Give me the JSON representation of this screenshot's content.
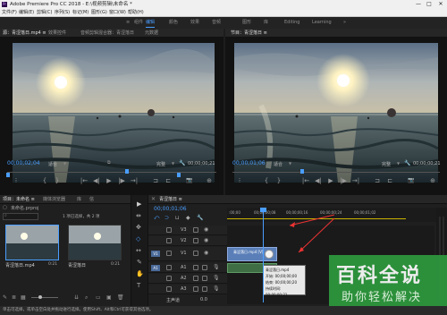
{
  "app": {
    "title": "Adobe Premiere Pro CC 2018 - E:\\视频剪辑\\未命名 *",
    "icon_label": "Pr",
    "window_controls": [
      "—",
      "□",
      "✕"
    ]
  },
  "menu": [
    "文件(F)",
    "编辑(E)",
    "剪辑(C)",
    "序列(S)",
    "标记(M)",
    "图形(G)",
    "窗口(W)",
    "帮助(H)"
  ],
  "workspaces": [
    "≡",
    "组件",
    "编辑",
    "颜色",
    "效果",
    "音频",
    "图形",
    "库",
    "Editing",
    "Learning",
    "»"
  ],
  "workspace_active": "编辑",
  "source_monitor": {
    "tabs": [
      "源：青涩落日.mp4 ≡",
      "效果控件",
      "音频剪辑混合器：青涩落日",
      "元数据"
    ],
    "timecode_left": "00;00;02;04",
    "fit": "适合",
    "quality": "完整",
    "timecode_right": "00;00;00;21"
  },
  "program_monitor": {
    "tab": "节目：青涩落日 ≡",
    "timecode_left": "00;00;01;06",
    "fit": "适合",
    "quality": "完整",
    "timecode_right": "00;00;00;21"
  },
  "transport": [
    "⁝",
    "{",
    "}",
    "|←",
    "◀|",
    "▶",
    "|▶",
    "→|",
    "⊐",
    "⊏",
    "📷",
    "⊕"
  ],
  "project": {
    "tabs": [
      "项目：未命名 ≡",
      "媒体浏览器",
      "库",
      "信"
    ],
    "file": "未命名.prproj",
    "count": "1 项已选择，共 2 项",
    "clips": [
      {
        "name": "青涩落日.mp4",
        "duration": "0:21"
      },
      {
        "name": "青涩落日",
        "duration": "0:21"
      }
    ]
  },
  "timeline": {
    "tab": "青涩落日 ≡",
    "timecode": "00;00;01;06",
    "ruler": [
      ":00;00",
      "00;00;00;08",
      "00;00;00;16",
      "00;00;00;24",
      "00;00;01;02"
    ],
    "video_tracks": [
      "V3",
      "V2",
      "V1"
    ],
    "audio_tracks": [
      "A1",
      "A2",
      "A3"
    ],
    "master": "主声道",
    "master_value": "0.0",
    "clip_label": "青涩落日.mp4 [V]",
    "tooltip": [
      "青涩落日.mp4",
      "开始: 00;00;00;00",
      "结束: 00;00;00;20",
      "持续时间: 00;00;00;21"
    ]
  },
  "tools": [
    "▶",
    "⇹",
    "✥",
    "◇",
    "↔",
    "✎",
    "✋",
    "T"
  ],
  "status": "单击可选择，或单击空白处并拖动进行选择。使用Shift、Alt和Ctrl可获得其他选项。",
  "watermark": {
    "title": "百科全说",
    "subtitle": "助你轻松解决"
  },
  "colors": {
    "accent": "#4a9eff",
    "clip_blue": "#5a7fb8",
    "watermark_green": "#2e9a3e"
  }
}
